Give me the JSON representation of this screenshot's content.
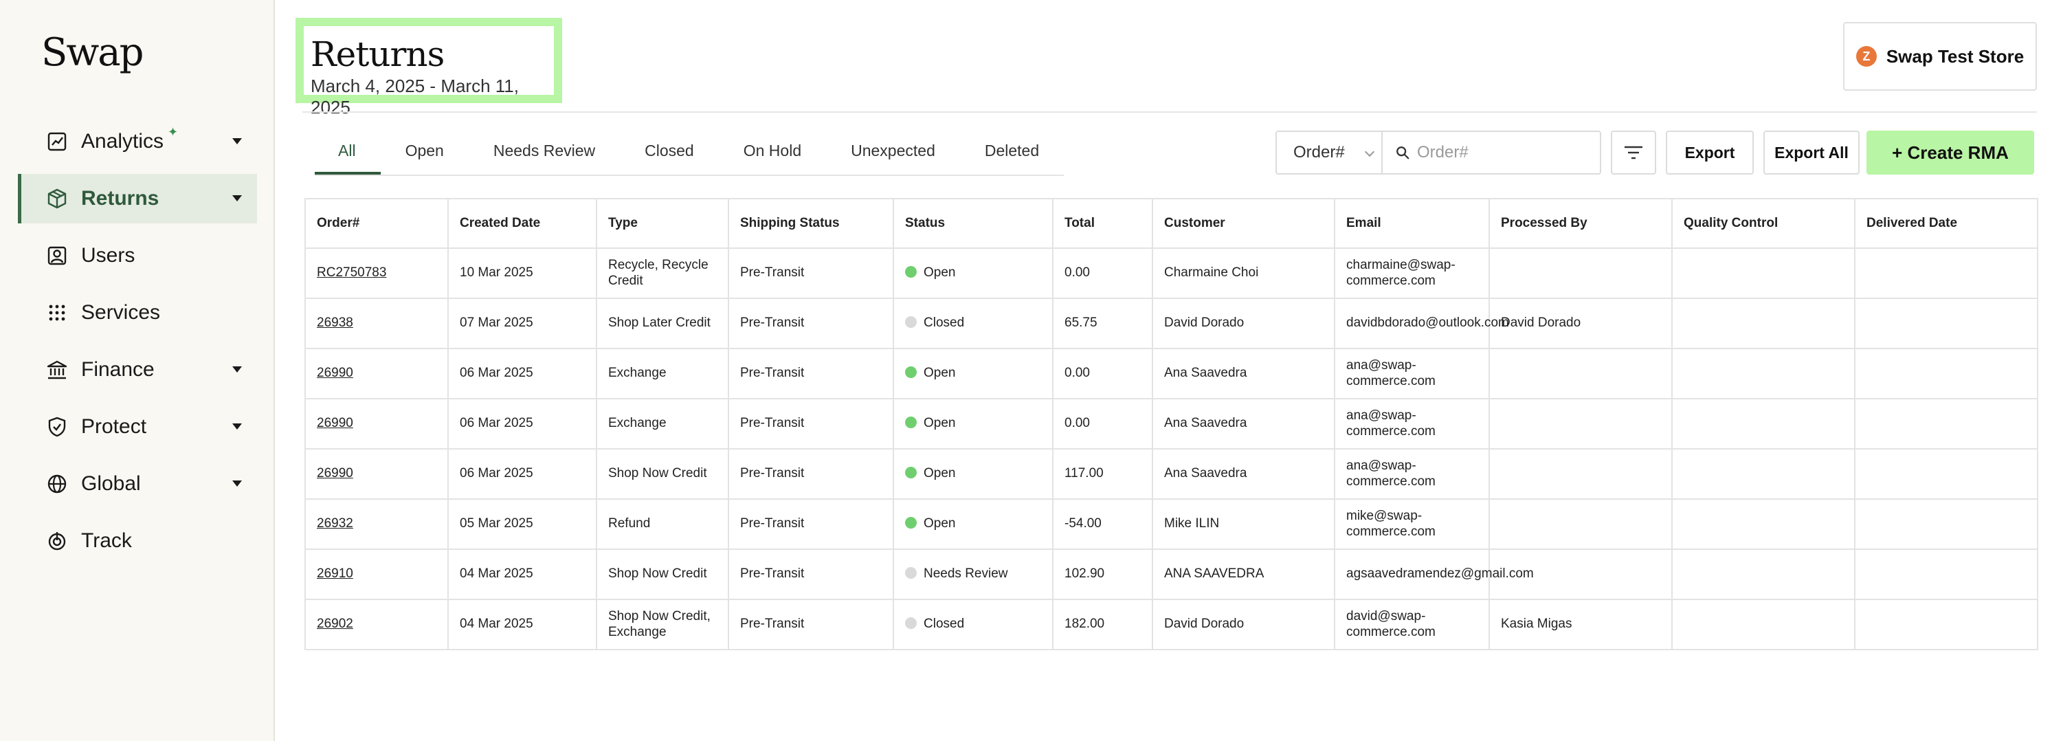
{
  "sidebar": {
    "logo": "Swap",
    "items": [
      {
        "label": "Analytics",
        "icon": "chart-line-icon",
        "has_caret": true
      },
      {
        "label": "Returns",
        "icon": "box-icon",
        "has_caret": true,
        "active": true
      },
      {
        "label": "Users",
        "icon": "user-icon",
        "has_caret": false
      },
      {
        "label": "Services",
        "icon": "grid-dots-icon",
        "has_caret": false
      },
      {
        "label": "Finance",
        "icon": "bank-icon",
        "has_caret": true
      },
      {
        "label": "Protect",
        "icon": "shield-check-icon",
        "has_caret": true
      },
      {
        "label": "Global",
        "icon": "globe-icon",
        "has_caret": true
      },
      {
        "label": "Track",
        "icon": "target-icon",
        "has_caret": false
      }
    ]
  },
  "header": {
    "title": "Returns",
    "date_range": "March 4, 2025 - March 11, 2025",
    "store_name": "Swap Test Store",
    "store_logo_letter": "Z",
    "highlight_color": "#b8f5a4"
  },
  "tabs": [
    {
      "label": "All",
      "active": true
    },
    {
      "label": "Open"
    },
    {
      "label": "Needs Review"
    },
    {
      "label": "Closed"
    },
    {
      "label": "On Hold"
    },
    {
      "label": "Unexpected"
    },
    {
      "label": "Deleted"
    }
  ],
  "toolbar": {
    "search_field_select": "Order#",
    "search_placeholder": "Order#",
    "export_label": "Export",
    "export_all_label": "Export All",
    "create_label": "+ Create RMA"
  },
  "table": {
    "columns": [
      "Order#",
      "Created Date",
      "Type",
      "Shipping Status",
      "Status",
      "Total",
      "Customer",
      "Email",
      "Processed By",
      "Quality Control",
      "Delivered Date"
    ],
    "rows": [
      {
        "order": "RC2750783",
        "created": "10 Mar 2025",
        "type": "Recycle, Recycle Credit",
        "shipping": "Pre-Transit",
        "status": "Open",
        "total": "0.00",
        "customer": "Charmaine Choi",
        "email": "charmaine@swap-commerce.com",
        "processed_by": "",
        "quality_control": "",
        "delivered": ""
      },
      {
        "order": "26938",
        "created": "07 Mar 2025",
        "type": "Shop Later Credit",
        "shipping": "Pre-Transit",
        "status": "Closed",
        "total": "65.75",
        "customer": "David Dorado",
        "email": "davidbdorado@outlook.com",
        "processed_by": "David Dorado",
        "quality_control": "",
        "delivered": ""
      },
      {
        "order": "26990",
        "created": "06 Mar 2025",
        "type": "Exchange",
        "shipping": "Pre-Transit",
        "status": "Open",
        "total": "0.00",
        "customer": "Ana Saavedra",
        "email": "ana@swap-commerce.com",
        "processed_by": "",
        "quality_control": "",
        "delivered": ""
      },
      {
        "order": "26990",
        "created": "06 Mar 2025",
        "type": "Exchange",
        "shipping": "Pre-Transit",
        "status": "Open",
        "total": "0.00",
        "customer": "Ana Saavedra",
        "email": "ana@swap-commerce.com",
        "processed_by": "",
        "quality_control": "",
        "delivered": ""
      },
      {
        "order": "26990",
        "created": "06 Mar 2025",
        "type": "Shop Now Credit",
        "shipping": "Pre-Transit",
        "status": "Open",
        "total": "117.00",
        "customer": "Ana Saavedra",
        "email": "ana@swap-commerce.com",
        "processed_by": "",
        "quality_control": "",
        "delivered": ""
      },
      {
        "order": "26932",
        "created": "05 Mar 2025",
        "type": "Refund",
        "shipping": "Pre-Transit",
        "status": "Open",
        "total": "-54.00",
        "customer": "Mike ILIN",
        "email": "mike@swap-commerce.com",
        "processed_by": "",
        "quality_control": "",
        "delivered": ""
      },
      {
        "order": "26910",
        "created": "04 Mar 2025",
        "type": "Shop Now Credit",
        "shipping": "Pre-Transit",
        "status": "Needs Review",
        "total": "102.90",
        "customer": "ANA SAAVEDRA",
        "email": "agsaavedramendez@gmail.com",
        "processed_by": "",
        "quality_control": "",
        "delivered": ""
      },
      {
        "order": "26902",
        "created": "04 Mar 2025",
        "type": "Shop Now Credit, Exchange",
        "shipping": "Pre-Transit",
        "status": "Closed",
        "total": "182.00",
        "customer": "David Dorado",
        "email": "david@swap-commerce.com",
        "processed_by": "Kasia Migas",
        "quality_control": "",
        "delivered": ""
      }
    ]
  },
  "status_colors": {
    "Open": "#6fcf6f",
    "Closed": "#d9d9d9",
    "Needs Review": "#d9d9d9"
  },
  "colors": {
    "accent": "#2f5a3c",
    "sidebar_bg": "#faf8f3",
    "create_button": "#b8f5a4"
  }
}
